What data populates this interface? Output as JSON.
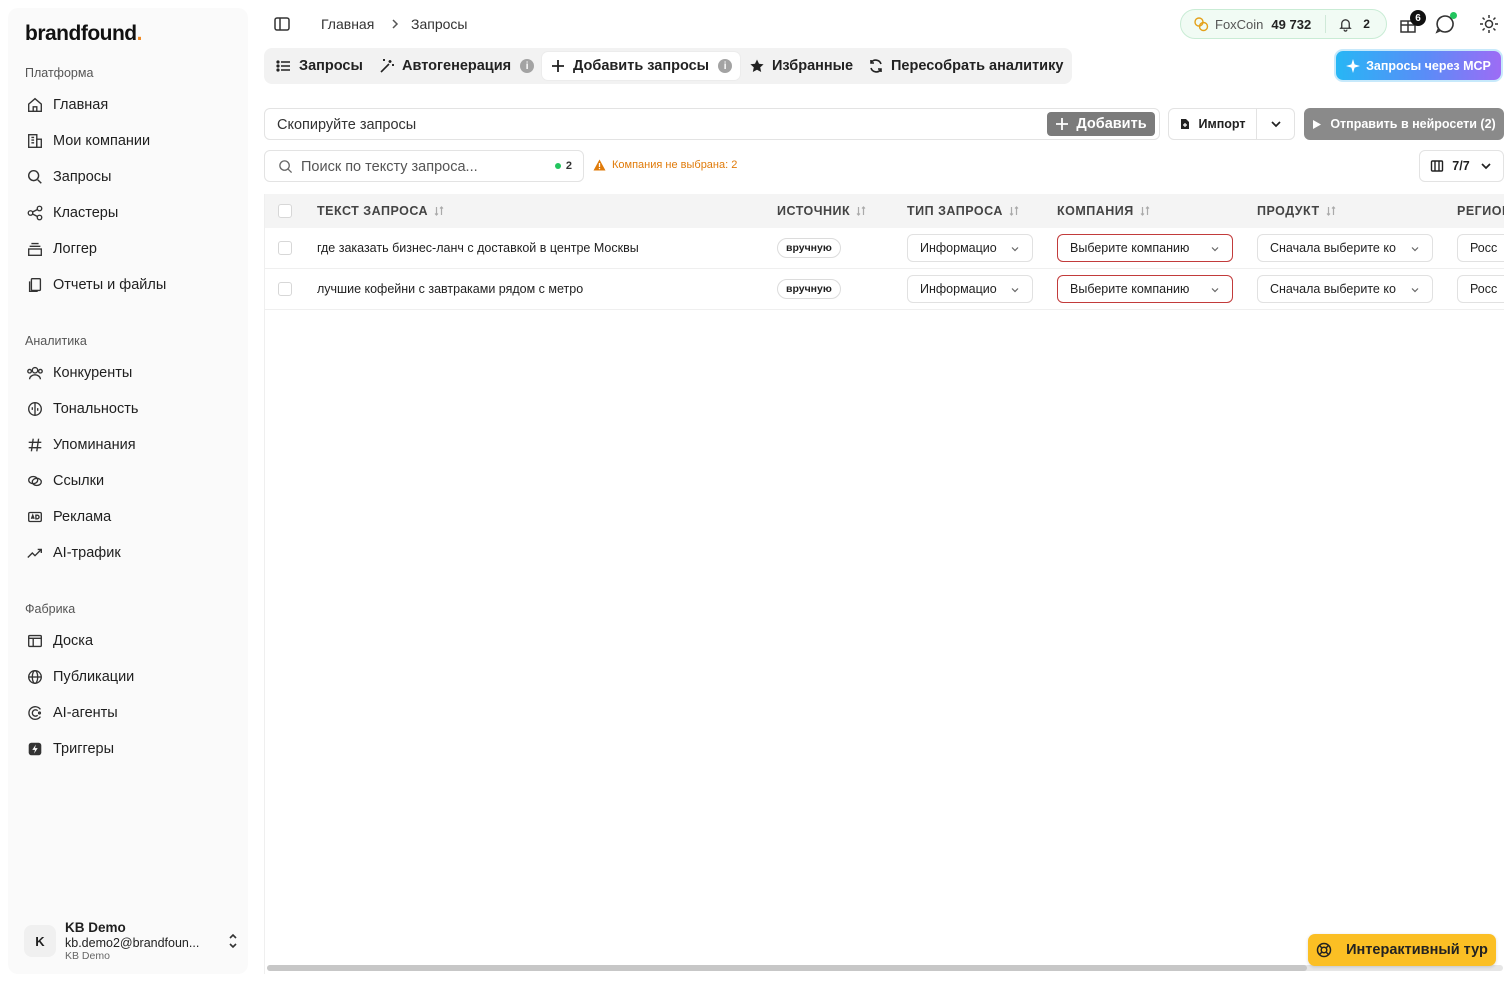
{
  "brand": {
    "name": "brandfound",
    "dot": "."
  },
  "sidebar": {
    "sections": [
      {
        "label": "Платформа",
        "items": [
          "Главная",
          "Мои компании",
          "Запросы",
          "Кластеры",
          "Логгер",
          "Отчеты и файлы"
        ]
      },
      {
        "label": "Аналитика",
        "items": [
          "Конкуренты",
          "Тональность",
          "Упоминания",
          "Ссылки",
          "Реклама",
          "AI-трафик"
        ]
      },
      {
        "label": "Фабрика",
        "items": [
          "Доска",
          "Публикации",
          "AI-агенты",
          "Триггеры"
        ]
      }
    ],
    "user": {
      "initial": "K",
      "name": "KB Demo",
      "email": "kb.demo2@brandfoun...",
      "org": "KB Demo"
    }
  },
  "header": {
    "breadcrumb": [
      "Главная",
      "Запросы"
    ],
    "coins": {
      "label": "FoxCoin",
      "value": "49 732",
      "notifications": "2"
    },
    "gift_badge": "6"
  },
  "tabs": [
    {
      "label": "Запросы",
      "icon": "list-icon"
    },
    {
      "label": "Автогенерация",
      "icon": "magic-wand-icon",
      "info": "i"
    },
    {
      "label": "Добавить запросы",
      "icon": "plus-icon",
      "info": "i",
      "active": true
    },
    {
      "label": "Избранные",
      "icon": "star-icon"
    },
    {
      "label": "Пересобрать аналитику",
      "icon": "refresh-icon"
    }
  ],
  "mcp_button": "Запросы через MCP",
  "paste": {
    "placeholder": "Скопируйте запросы",
    "add_label": "Добавить"
  },
  "import_label": "Импорт",
  "send_label": "Отправить в нейросети (2)",
  "search": {
    "placeholder": "Поиск по тексту запроса...",
    "count": "2"
  },
  "warning": "Компания не выбрана: 2",
  "columns_toggle": "7/7",
  "table": {
    "headers": [
      "ТЕКСТ ЗАПРОСА",
      "ИСТОЧНИК",
      "ТИП ЗАПРОСА",
      "КОМПАНИЯ",
      "ПРОДУКТ",
      "РЕГИОН"
    ],
    "rows": [
      {
        "text": "где заказать бизнес-ланч с доставкой в центре Москвы",
        "source": "вручную",
        "type": "Информацио",
        "company": "Выберите компанию",
        "product": "Сначала выберите ко",
        "region": "Росс"
      },
      {
        "text": "лучшие кофейни с завтраками рядом с метро",
        "source": "вручную",
        "type": "Информацио",
        "company": "Выберите компанию",
        "product": "Сначала выберите ко",
        "region": "Росс"
      }
    ]
  },
  "tour_label": "Интерактивный тур",
  "colors": {
    "accent_green": "#22c55e",
    "warning": "#e07b0a",
    "error_border": "#c23b3b",
    "tour": "#fbbf24"
  }
}
